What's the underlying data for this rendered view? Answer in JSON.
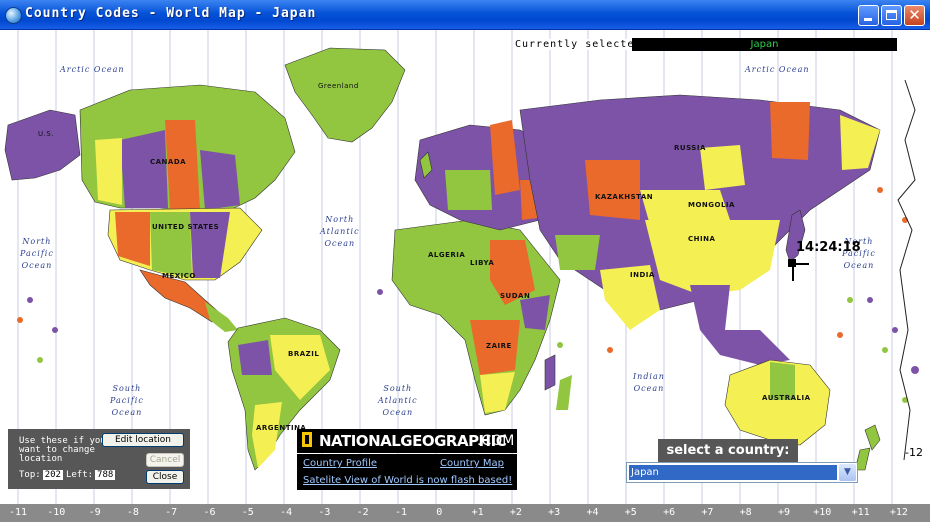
{
  "window": {
    "title": "Country Codes - World Map - Japan",
    "icon": "globe-icon"
  },
  "selection": {
    "label": "Currently selected:",
    "value": "Japan"
  },
  "clock": {
    "time": "14:24:18"
  },
  "oceans": [
    {
      "name": "Arctic Ocean"
    },
    {
      "name": "Arctic Ocean"
    },
    {
      "name": "North\nAtlantic\nOcean"
    },
    {
      "name": "North\nPacific\nOcean"
    },
    {
      "name": "South\nPacific\nOcean"
    },
    {
      "name": "South\nAtlantic\nOcean"
    },
    {
      "name": "Indian\nOcean"
    },
    {
      "name": "North\nPacific\nOcean"
    }
  ],
  "countries": [
    "CANADA",
    "UNITED STATES",
    "MEXICO",
    "BRAZIL",
    "ARGENTINA",
    "RUSSIA",
    "CHINA",
    "MONGOLIA",
    "INDIA",
    "ALGERIA",
    "LIBYA",
    "SUDAN",
    "ZAIRE",
    "AUSTRALIA",
    "KAZAKHSTAN",
    "Greenland",
    "U.S."
  ],
  "edit_panel": {
    "hint": "Use these if you want to change location",
    "edit_label": "Edit location",
    "cancel_label": "Cancel",
    "close_label": "Close",
    "top_label": "Top:",
    "top_value": "202",
    "left_label": "Left:",
    "left_value": "788"
  },
  "natgeo": {
    "brand": "NATIONALGEOGRAPHIC",
    "dotcom": ".COM",
    "country_profile": "Country Profile",
    "country_map": "Country Map",
    "satellite": "Satelite View of World is now flash based!"
  },
  "country_select": {
    "heading": "select a country:",
    "value": "Japan"
  },
  "timezones": [
    "-11",
    "-10",
    "-9",
    "-8",
    "-7",
    "-6",
    "-5",
    "-4",
    "-3",
    "-2",
    "-1",
    "0",
    "+1",
    "+2",
    "+3",
    "+4",
    "+5",
    "+6",
    "+7",
    "+8",
    "+9",
    "+10",
    "+11",
    "+12",
    "-11"
  ],
  "timezone_edge_label": "-12",
  "colors": {
    "green": "#92c540",
    "purple": "#7d53a8",
    "orange": "#ea6a2c",
    "yellow": "#f4ef52",
    "titlebar": "#0553d8",
    "panel": "#575757"
  }
}
